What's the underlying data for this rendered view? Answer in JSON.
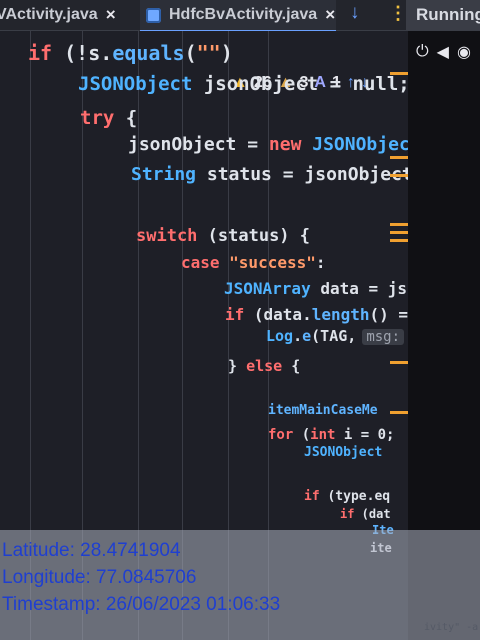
{
  "tabs": [
    {
      "label": "VActivity.java",
      "close": "×"
    },
    {
      "label": "HdfcBvActivity.java",
      "close": "×"
    }
  ],
  "toolbar": {
    "run_label": "Running",
    "download_icon": "↓",
    "more_icon": "⋮"
  },
  "inspections": {
    "warnings": "26",
    "weak_warnings": "3",
    "typos": "1"
  },
  "code": {
    "l1": {
      "kw": "if",
      "rest": " (!s.",
      "method": "equals",
      "open": "(",
      "str": "\"\"",
      "close": ")"
    },
    "l2": {
      "type": "JSONObject",
      "rest": " jsonObject = null;"
    },
    "l3": {
      "kw": "try",
      "rest": " {"
    },
    "l4": {
      "var": "jsonObject = ",
      "kw": "new",
      "type": " JSONObject"
    },
    "l5": {
      "type": "String",
      "rest": " status = jsonObject."
    },
    "l6": {
      "kw": "switch",
      "rest": " (status) {"
    },
    "l7": {
      "kw": "case",
      "str": " \"success\"",
      "rest": ":"
    },
    "l8": {
      "type": "JSONArray",
      "rest": " data = js"
    },
    "l9": {
      "kw": "if",
      "rest": " (data.",
      "method": "length",
      "tail": "() ="
    },
    "l10": {
      "type": "Log",
      "rest": ".",
      "method": "e",
      "tail": "(TAG,",
      "hint": "msg:"
    },
    "l11": {
      "rest": "} ",
      "kw": "else",
      "tail": " {"
    },
    "l12": {
      "var": "itemMainCaseMe"
    },
    "l13": {
      "kw": "for",
      "rest": " (",
      "kw2": "int",
      "tail": " i = 0;"
    },
    "l14": {
      "type": "JSONObject"
    },
    "l15": {
      "kw": "if",
      "rest": " (type.eq"
    },
    "l16": {
      "kw": "if",
      "rest": " (dat"
    },
    "l17": {
      "var": "Ite"
    },
    "l18": {
      "var": "ite"
    }
  },
  "location": {
    "latitude": "Latitude: 28.4741904",
    "longitude": "Longitude: 77.0845706",
    "timestamp": "Timestamp: 26/06/2023 01:06:33"
  },
  "bottom_fragment": "ivity\" -a"
}
